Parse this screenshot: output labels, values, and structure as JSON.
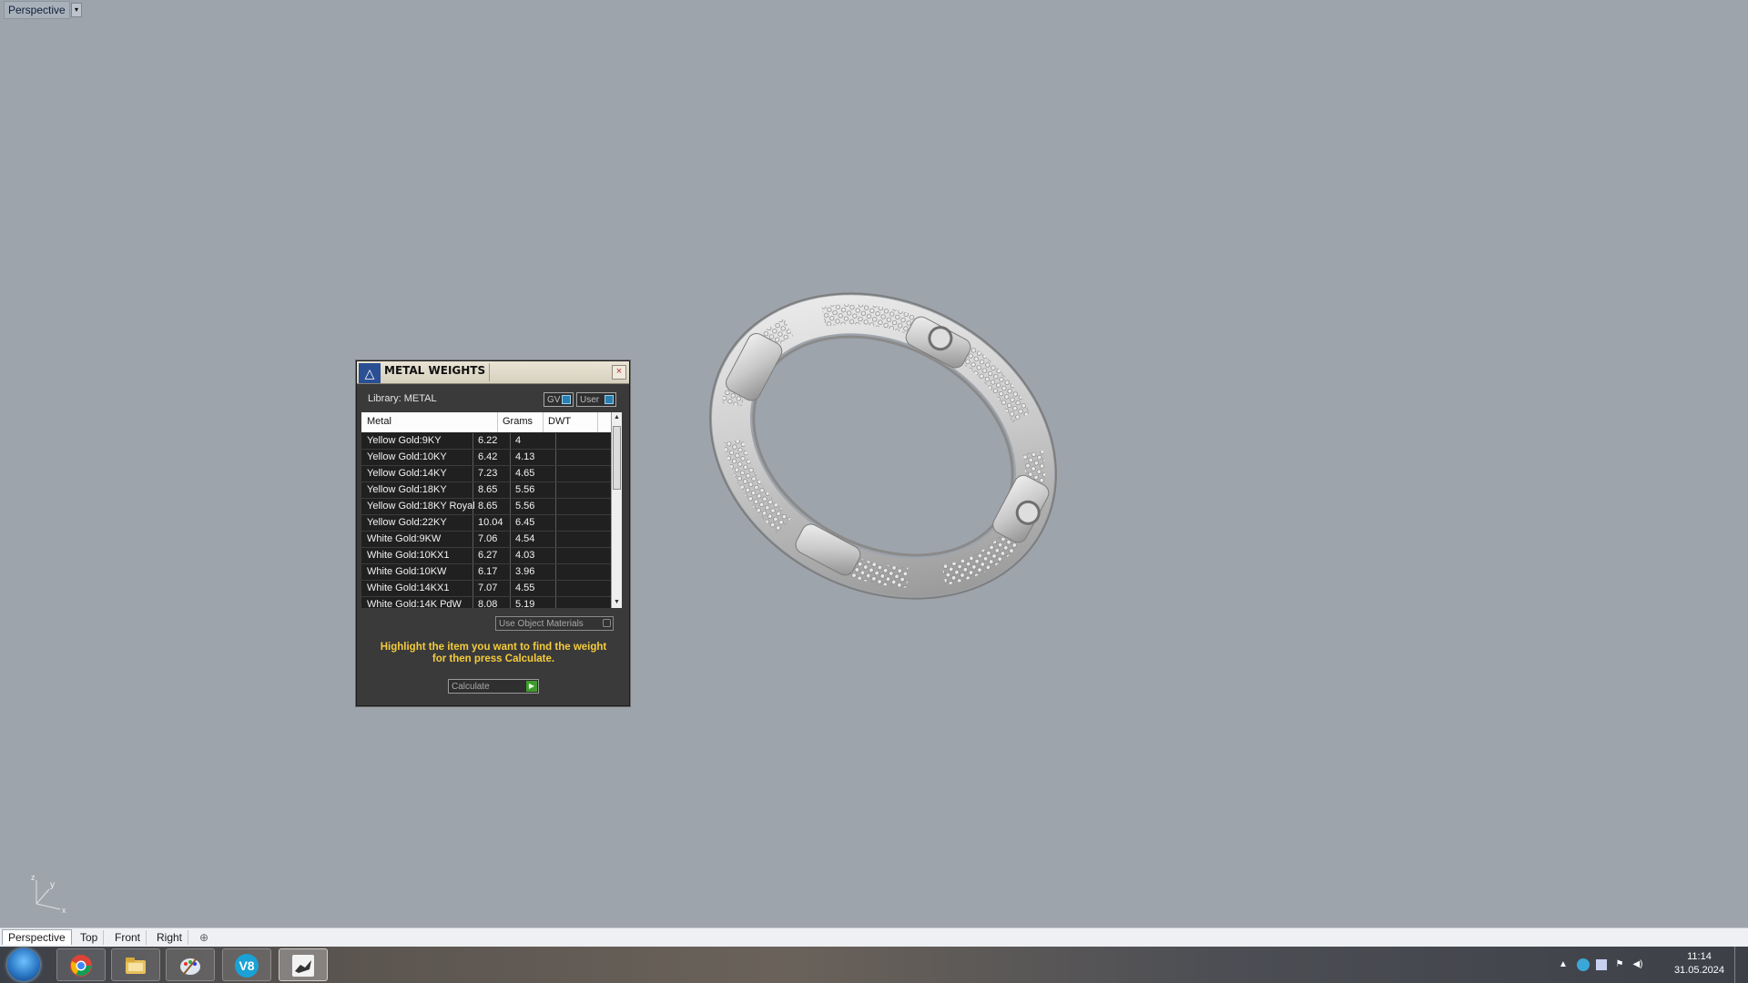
{
  "viewport": {
    "label": "Perspective",
    "menu_arrow": "▾"
  },
  "dialog": {
    "title": "METAL WEIGHTS",
    "close_glyph": "×",
    "library_label": "Library: METAL",
    "source_buttons": [
      "GV",
      "User"
    ],
    "columns": [
      "Metal",
      "Grams",
      "DWT"
    ],
    "rows": [
      {
        "metal": "Yellow Gold:9KY",
        "grams": "6.22",
        "dwt": "4"
      },
      {
        "metal": "Yellow Gold:10KY",
        "grams": "6.42",
        "dwt": "4.13"
      },
      {
        "metal": "Yellow Gold:14KY",
        "grams": "7.23",
        "dwt": "4.65"
      },
      {
        "metal": "Yellow Gold:18KY",
        "grams": "8.65",
        "dwt": "5.56"
      },
      {
        "metal": "Yellow Gold:18KY Royal",
        "grams": "8.65",
        "dwt": "5.56"
      },
      {
        "metal": "Yellow Gold:22KY",
        "grams": "10.04",
        "dwt": "6.45"
      },
      {
        "metal": "White Gold:9KW",
        "grams": "7.06",
        "dwt": "4.54"
      },
      {
        "metal": "White Gold:10KX1",
        "grams": "6.27",
        "dwt": "4.03"
      },
      {
        "metal": "White Gold:10KW",
        "grams": "6.17",
        "dwt": "3.96"
      },
      {
        "metal": "White Gold:14KX1",
        "grams": "7.07",
        "dwt": "4.55"
      },
      {
        "metal": "White Gold:14K PdW",
        "grams": "8.08",
        "dwt": "5.19"
      }
    ],
    "use_object_materials": "Use Object Materials",
    "hint_line1": "Highlight the item you want to find the weight",
    "hint_line2": "for then press Calculate.",
    "calculate_label": "Calculate",
    "colors": {
      "hint": "#f4cc3c",
      "go": "#3f9b2d",
      "source_square": "#2a7fb0"
    }
  },
  "axis": {
    "x": "x",
    "y": "y",
    "z": "z"
  },
  "viewport_tabs": [
    "Perspective",
    "Top",
    "Front",
    "Right"
  ],
  "tab_add_glyph": "⊕",
  "taskbar": {
    "apps": [
      "chrome-icon",
      "file-explorer-icon",
      "paint-icon",
      "v8-icon",
      "rhino-icon"
    ],
    "v8_text": "V8",
    "tray_arrow": "▲",
    "time": "11:14",
    "date": "31.05.2024"
  }
}
